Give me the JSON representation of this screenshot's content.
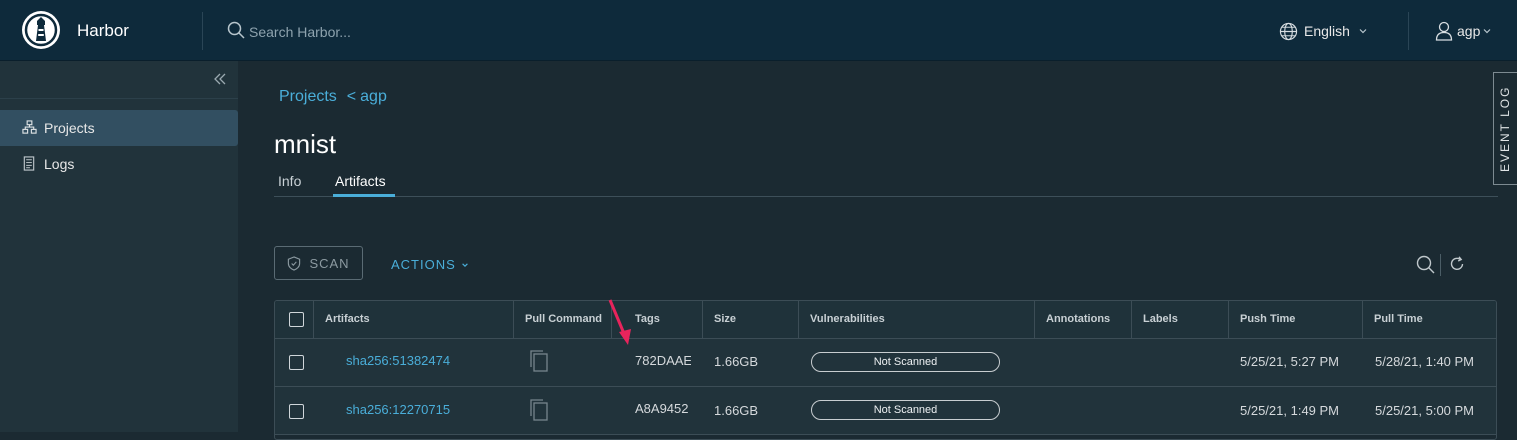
{
  "header": {
    "brand": "Harbor",
    "search_placeholder": "Search Harbor...",
    "language": "English",
    "user": "agp"
  },
  "sidebar": {
    "items": [
      {
        "label": "Projects",
        "icon": "projects-icon",
        "active": true
      },
      {
        "label": "Logs",
        "icon": "logs-icon",
        "active": false
      }
    ]
  },
  "breadcrumb": {
    "projects": "Projects",
    "separator": "<",
    "project": "agp"
  },
  "page": {
    "title": "mnist"
  },
  "tabs": [
    {
      "label": "Info",
      "active": false
    },
    {
      "label": "Artifacts",
      "active": true
    }
  ],
  "toolbar": {
    "scan_label": "SCAN",
    "actions_label": "ACTIONS"
  },
  "table": {
    "columns": [
      "Artifacts",
      "Pull Command",
      "Tags",
      "Size",
      "Vulnerabilities",
      "Annotations",
      "Labels",
      "Push Time",
      "Pull Time"
    ],
    "rows": [
      {
        "artifact": "sha256:51382474",
        "tags": "782DAAE",
        "size": "1.66GB",
        "vulnerabilities": "Not Scanned",
        "annotations": "",
        "labels": "",
        "push_time": "5/25/21, 5:27 PM",
        "pull_time": "5/28/21, 1:40 PM"
      },
      {
        "artifact": "sha256:12270715",
        "tags": "A8A9452",
        "size": "1.66GB",
        "vulnerabilities": "Not Scanned",
        "annotations": "",
        "labels": "",
        "push_time": "5/25/21, 1:49 PM",
        "pull_time": "5/25/21, 5:00 PM"
      }
    ]
  },
  "event_log": {
    "label": "EVENT LOG"
  },
  "colors": {
    "header_bg": "#0e2a3b",
    "accent": "#4aaed9",
    "annotation_arrow": "#e8245c"
  }
}
